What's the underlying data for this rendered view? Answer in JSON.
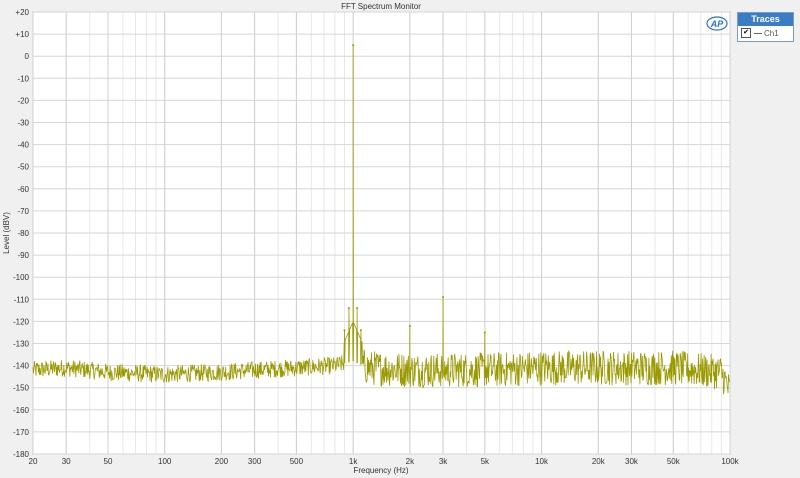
{
  "legend": {
    "title": "Traces",
    "items": [
      {
        "label": "Ch1",
        "checked": true,
        "color": "#9a9a00"
      }
    ]
  },
  "logo": {
    "text": "AP"
  },
  "chart_data": {
    "type": "line",
    "title": "FFT Spectrum Monitor",
    "xlabel": "Frequency (Hz)",
    "ylabel": "Level (dBV)",
    "x_scale": "log",
    "xlim": [
      20,
      100000
    ],
    "ylim": [
      -180,
      20
    ],
    "y_ticks": [
      20,
      10,
      0,
      -10,
      -20,
      -30,
      -40,
      -50,
      -60,
      -70,
      -80,
      -90,
      -100,
      -110,
      -120,
      -130,
      -140,
      -150,
      -160,
      -170,
      -180
    ],
    "y_tick_labels": [
      "+20",
      "+10",
      "0",
      "-10",
      "-20",
      "-30",
      "-40",
      "-50",
      "-60",
      "-70",
      "-80",
      "-90",
      "-100",
      "-110",
      "-120",
      "-130",
      "-140",
      "-150",
      "-160",
      "-170",
      "-180"
    ],
    "x_ticks": [
      20,
      30,
      50,
      100,
      200,
      300,
      500,
      1000,
      2000,
      3000,
      5000,
      10000,
      20000,
      30000,
      50000,
      100000
    ],
    "x_tick_labels": [
      "20",
      "30",
      "50",
      "100",
      "200",
      "300",
      "500",
      "1k",
      "2k",
      "3k",
      "5k",
      "10k",
      "20k",
      "30k",
      "50k",
      "100k"
    ],
    "grid": true,
    "legend_position": "top-right",
    "series": [
      {
        "name": "Ch1",
        "color": "#9a9a00",
        "noise_floor": [
          [
            20,
            -142
          ],
          [
            30,
            -141
          ],
          [
            50,
            -143
          ],
          [
            100,
            -144
          ],
          [
            200,
            -143
          ],
          [
            300,
            -142
          ],
          [
            500,
            -141
          ],
          [
            800,
            -140
          ],
          [
            1000,
            -138
          ],
          [
            1200,
            -141
          ],
          [
            2000,
            -142
          ],
          [
            3000,
            -142
          ],
          [
            5000,
            -142
          ],
          [
            10000,
            -141
          ],
          [
            20000,
            -141
          ],
          [
            30000,
            -141
          ],
          [
            50000,
            -141
          ],
          [
            90000,
            -143
          ],
          [
            100000,
            -152
          ]
        ],
        "peaks": [
          [
            900,
            -124
          ],
          [
            950,
            -114
          ],
          [
            1000,
            5
          ],
          [
            1050,
            -114
          ],
          [
            1100,
            -124
          ],
          [
            2000,
            -122
          ],
          [
            3000,
            -109
          ],
          [
            5000,
            -125
          ]
        ]
      }
    ]
  }
}
